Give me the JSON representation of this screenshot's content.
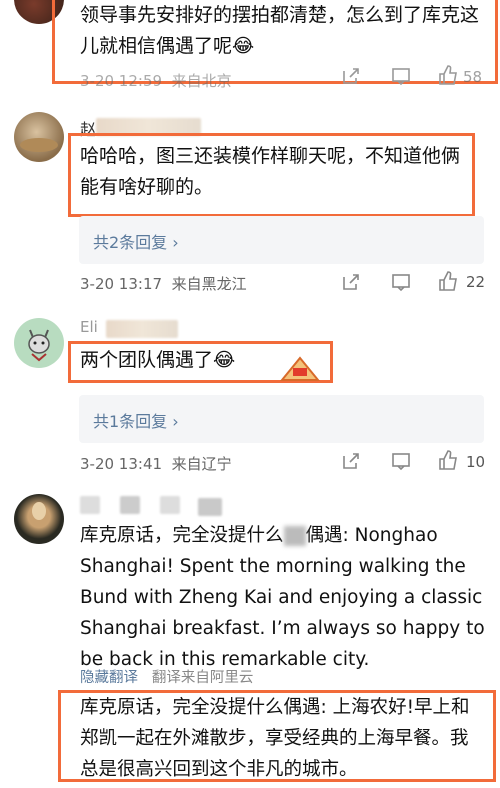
{
  "comments": [
    {
      "text": "领导事先安排好的摆拍都清楚，怎么到了库克这儿就相信偶遇了呢😂",
      "time": "3-20 12:59",
      "location": "来自北京",
      "likes": "58"
    },
    {
      "name": "赵",
      "text": "哈哈哈，图三还装模作样聊天呢，不知道他俩能有啥好聊的。",
      "replies": "共2条回复 ›",
      "time": "3-20 13:17",
      "location": "来自黑龙江",
      "likes": "22"
    },
    {
      "name": "Eli",
      "text": "两个团队偶遇了😂",
      "replies": "共1条回复 ›",
      "time": "3-20 13:41",
      "location": "来自辽宁",
      "likes": "10"
    },
    {
      "text_cn_prefix": "库克原话，完全没提什么",
      "text_cn_mid": "偶遇: Nonghao",
      "text_en": "Shanghai! Spent the morning walking the Bund with Zheng Kai and enjoying a classic Shanghai breakfast. I’m always so happy to be back in this remarkable city.",
      "hide_translation": "隐藏翻译",
      "translation_source": "翻译来自阿里云",
      "translation": "库克原话，完全没提什么偶遇: 上海农好!早上和郑凯一起在外滩散步，享受经典的上海早餐。我总是很高兴回到这个非凡的城市。"
    }
  ],
  "colors": {
    "highlight_border": "#f26b3a",
    "link_blue": "#5b7a9c",
    "meta_gray": "#666666"
  }
}
